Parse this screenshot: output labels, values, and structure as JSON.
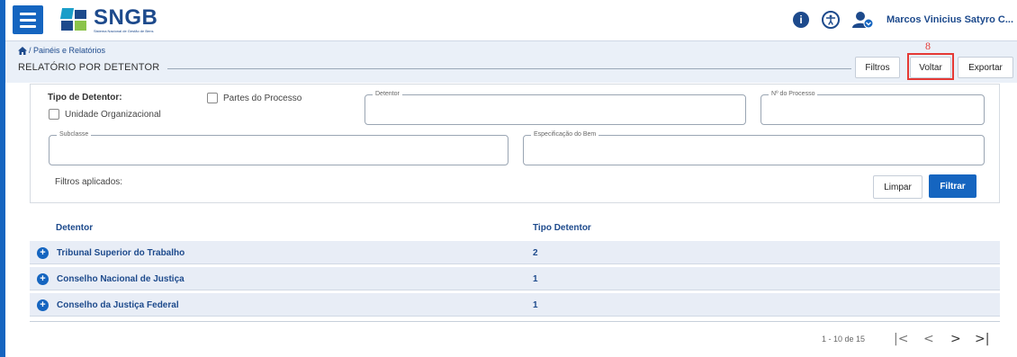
{
  "header": {
    "logo_text": "SNGB",
    "logo_sub": "Sistema Nacional de Gestão de Bens",
    "user_name": "Marcos Vinicius Satyro C...",
    "icons": [
      "menu-icon",
      "info-icon",
      "accessibility-icon",
      "user-icon"
    ]
  },
  "breadcrumb": {
    "text": "/ Painéis e Relatórios"
  },
  "page": {
    "title": "RELATÓRIO POR DETENTOR"
  },
  "actions": {
    "filtros": "Filtros",
    "voltar": "Voltar",
    "exportar": "Exportar",
    "annotation_number": "8",
    "annotation_color": "#e53935"
  },
  "filters": {
    "tipo_detentor_label": "Tipo de Detentor:",
    "unidade_org_label": "Unidade Organizacional",
    "partes_processo_label": "Partes do Processo",
    "detentor_legend": "Detentor",
    "detentor_value": "",
    "num_processo_legend": "Nº do Processo",
    "num_processo_value": "",
    "subclasse_legend": "Subclasse",
    "subclasse_value": "",
    "especificacao_legend": "Especificação do Bem",
    "especificacao_value": "",
    "applied_label": "Filtros aplicados:",
    "limpar": "Limpar",
    "filtrar": "Filtrar"
  },
  "table": {
    "columns": [
      "Detentor",
      "Tipo Detentor"
    ],
    "rows": [
      {
        "detentor": "Tribunal Superior do Trabalho",
        "tipo": "2"
      },
      {
        "detentor": "Conselho Nacional de Justiça",
        "tipo": "1"
      },
      {
        "detentor": "Conselho da Justiça Federal",
        "tipo": "1"
      }
    ]
  },
  "pagination": {
    "range_text": "1 - 10 de 15",
    "first": "|<",
    "prev": "<",
    "next": ">",
    "last": ">|"
  },
  "colors": {
    "primary": "#1565c0",
    "brand_dark": "#1d4a8c",
    "row_bg": "#e8edf6",
    "highlight": "#e53935"
  }
}
